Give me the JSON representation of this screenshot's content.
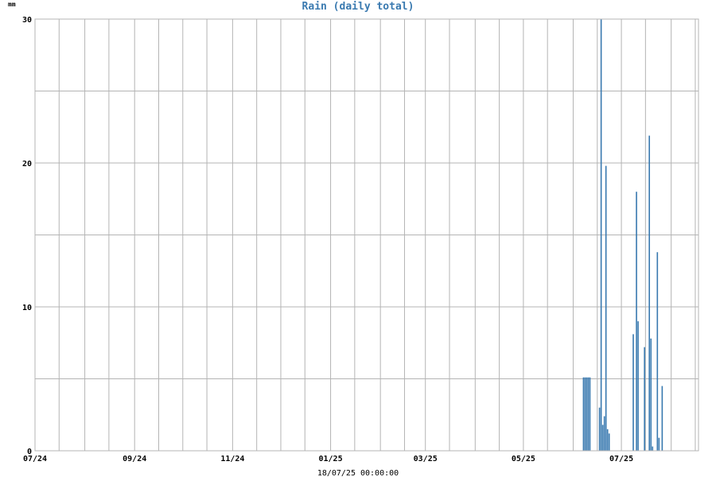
{
  "chart_data": {
    "type": "bar",
    "title": "Rain (daily total)",
    "ylabel": "mm",
    "xlabel": "18/07/25 00:00:00",
    "ylim": [
      0,
      30
    ],
    "yticks": [
      0,
      10,
      20,
      30
    ],
    "xlim": [
      "2024-07-01",
      "2025-08-18"
    ],
    "xticks": [
      {
        "date": "2024-07-01",
        "label": "07/24"
      },
      {
        "date": "2024-09-01",
        "label": "09/24"
      },
      {
        "date": "2024-11-01",
        "label": "11/24"
      },
      {
        "date": "2025-01-01",
        "label": "01/25"
      },
      {
        "date": "2025-03-01",
        "label": "03/25"
      },
      {
        "date": "2025-05-01",
        "label": "05/25"
      },
      {
        "date": "2025-07-01",
        "label": "07/25"
      }
    ],
    "grid": true,
    "bar_color": "#3a7ab0",
    "grid_color": "#b4b4b4",
    "series": [
      {
        "points": [
          {
            "x": "2025-06-07",
            "y": 5.1
          },
          {
            "x": "2025-06-08",
            "y": 5.1
          },
          {
            "x": "2025-06-09",
            "y": 5.1
          },
          {
            "x": "2025-06-10",
            "y": 5.1
          },
          {
            "x": "2025-06-11",
            "y": 5.1
          },
          {
            "x": "2025-06-17",
            "y": 3.0
          },
          {
            "x": "2025-06-18",
            "y": 30.0
          },
          {
            "x": "2025-06-19",
            "y": 1.8
          },
          {
            "x": "2025-06-20",
            "y": 2.4
          },
          {
            "x": "2025-06-21",
            "y": 19.8
          },
          {
            "x": "2025-06-22",
            "y": 1.5
          },
          {
            "x": "2025-06-23",
            "y": 1.2
          },
          {
            "x": "2025-07-08",
            "y": 8.1
          },
          {
            "x": "2025-07-10",
            "y": 18.0
          },
          {
            "x": "2025-07-11",
            "y": 9.0
          },
          {
            "x": "2025-07-15",
            "y": 7.2
          },
          {
            "x": "2025-07-18",
            "y": 21.9
          },
          {
            "x": "2025-07-19",
            "y": 7.8
          },
          {
            "x": "2025-07-20",
            "y": 0.3
          },
          {
            "x": "2025-07-23",
            "y": 13.8
          },
          {
            "x": "2025-07-24",
            "y": 0.9
          },
          {
            "x": "2025-07-26",
            "y": 4.5
          }
        ]
      }
    ]
  }
}
